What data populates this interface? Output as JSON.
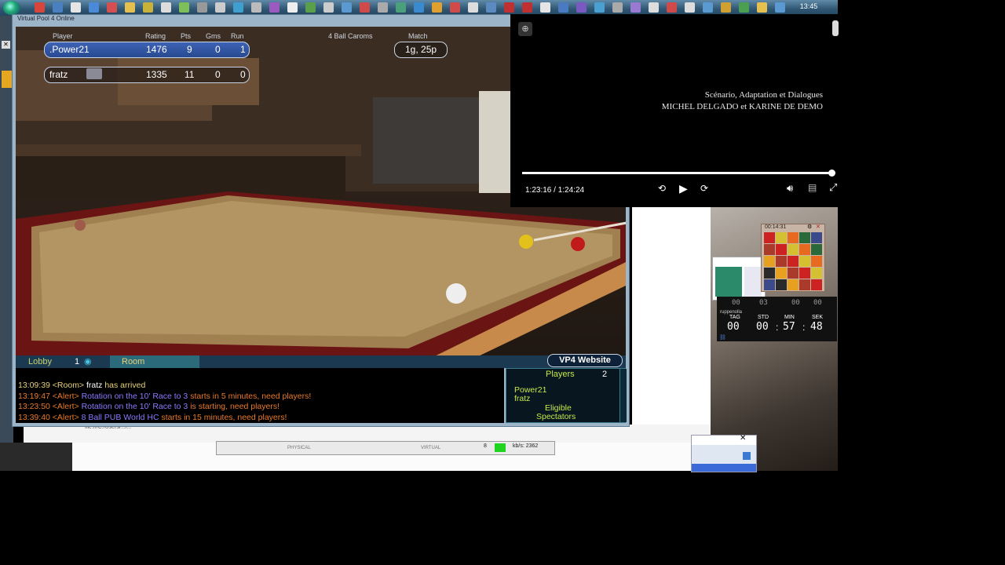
{
  "taskbar": {
    "clock": "13:45",
    "icons": [
      {
        "name": "browser-icon",
        "color": "#d9453a"
      },
      {
        "name": "search-icon",
        "color": "#4a7fc1"
      },
      {
        "name": "app-icon",
        "color": "#e5e5e5"
      },
      {
        "name": "shield-icon",
        "color": "#4a8ad8"
      },
      {
        "name": "mail-icon",
        "color": "#d45050"
      },
      {
        "name": "folder-icon",
        "color": "#e5c050"
      },
      {
        "name": "key-icon",
        "color": "#c9b23a"
      },
      {
        "name": "monitor-icon",
        "color": "#ddd"
      },
      {
        "name": "network-icon",
        "color": "#7fbf5a"
      },
      {
        "name": "settings-icon",
        "color": "#999"
      },
      {
        "name": "disc-icon",
        "color": "#ccc"
      },
      {
        "name": "globe-icon",
        "color": "#3fa0d0"
      },
      {
        "name": "app-icon",
        "color": "#bbb"
      },
      {
        "name": "media-icon",
        "color": "#9a5ac0"
      },
      {
        "name": "document-icon",
        "color": "#eee"
      },
      {
        "name": "leaf-icon",
        "color": "#5aa04a"
      },
      {
        "name": "star-icon",
        "color": "#ccc"
      },
      {
        "name": "chart-icon",
        "color": "#5a9ad0"
      },
      {
        "name": "image-icon",
        "color": "#d04a4a"
      },
      {
        "name": "gear-icon",
        "color": "#aaa"
      },
      {
        "name": "map-icon",
        "color": "#4aa07a"
      },
      {
        "name": "web-icon",
        "color": "#3a8ad0"
      },
      {
        "name": "edit-icon",
        "color": "#e0a030"
      },
      {
        "name": "play-icon",
        "color": "#d04a4a"
      },
      {
        "name": "sync-icon",
        "color": "#ddd"
      },
      {
        "name": "cloud-icon",
        "color": "#5a8ac0"
      },
      {
        "name": "record-icon",
        "color": "#c03030"
      },
      {
        "name": "record-icon",
        "color": "#c03030"
      },
      {
        "name": "cursor-icon",
        "color": "#e5e5e5"
      },
      {
        "name": "app-icon",
        "color": "#4a7ac0"
      },
      {
        "name": "chat-icon",
        "color": "#7a5ac0"
      },
      {
        "name": "check-icon",
        "color": "#4aa0d0"
      },
      {
        "name": "app-icon",
        "color": "#aaa"
      },
      {
        "name": "circle-icon",
        "color": "#9a7ad0"
      },
      {
        "name": "volume-icon",
        "color": "#ddd"
      },
      {
        "name": "flag-icon",
        "color": "#d04a4a"
      },
      {
        "name": "power-icon",
        "color": "#ddd"
      },
      {
        "name": "globe-icon",
        "color": "#5a9ad0"
      },
      {
        "name": "chrome-icon",
        "color": "#d0a030"
      },
      {
        "name": "chrome-icon",
        "color": "#4aa050"
      },
      {
        "name": "folder-icon",
        "color": "#e5c050"
      },
      {
        "name": "app-icon",
        "color": "#5a9ad0"
      }
    ]
  },
  "game": {
    "window_title": "Virtual Pool 4 Online",
    "headers": {
      "player": "Player",
      "rating": "Rating",
      "pts": "Pts",
      "gms": "Gms",
      "run": "Run",
      "mode": "4 Ball Caroms",
      "match": "Match"
    },
    "match_value": "1g, 25p",
    "players": [
      {
        "name": ".Power21",
        "rating": "1476",
        "pts": "9",
        "gms": "0",
        "run": "1"
      },
      {
        "name": "fratz",
        "rating": "1335",
        "pts": "11",
        "gms": "0",
        "run": "0"
      }
    ],
    "tabs": {
      "lobby": "Lobby",
      "lobby_count": "1",
      "room": "Room"
    },
    "website_button": "VP4 Website",
    "chat": [
      {
        "time": "13:09:39",
        "tag": "<Room>",
        "text": "fratz has arrived",
        "user": "fratz",
        "rest": " has arrived"
      },
      {
        "time": "13:19:47",
        "tag": "<Alert>",
        "text": "Rotation on the 10' Race to 3 starts in 5 minutes, need players!",
        "pre": "Rotation on the 10' Race to 3 ",
        "post": "starts in 5 minutes, need players!"
      },
      {
        "time": "13:23:50",
        "tag": "<Alert>",
        "text": "Rotation on the 10' Race to 3 is starting, need players!",
        "pre": "Rotation on the 10' Race to 3 ",
        "post": "is starting, need players!"
      },
      {
        "time": "13:39:40",
        "tag": "<Alert>",
        "text": "8 Ball PUB World HC starts in 15 minutes, need players!",
        "pre": "8 Ball PUB World HC ",
        "post": "starts in 15 minutes, need players!"
      }
    ],
    "players_panel": {
      "title": "Players",
      "count": "2",
      "names": [
        "Power21",
        "fratz"
      ],
      "eligible": "Eligible",
      "spectators": "Spectators"
    },
    "colors": {
      "chat_time": "#e87a2a",
      "chat_text_alert": "#8a7aff",
      "chat_alert_post": "#e87a2a",
      "chat_user": "#ffffff",
      "chat_room_msg": "#e8d27a",
      "player_names": "#c8e84a",
      "table_felt": "#b39463"
    }
  },
  "video": {
    "credits_line1": "Scénario, Adaptation et Dialogues",
    "credits_line2": "MICHEL DELGADO et KARINE DE DEMO",
    "time": "1:23:16 / 1:24:24",
    "progress": 0.987
  },
  "widgets": {
    "puzzle_time": "00:14:31",
    "timer_top": [
      "00",
      "03",
      "00",
      "00"
    ],
    "timer_user": "ruppenolla",
    "timer_labels": [
      "TAG",
      "STD",
      "MIN",
      "SEK"
    ],
    "timer_values": [
      "00",
      "00",
      "57",
      "48"
    ]
  },
  "status": {
    "desktop_text": "file:///C:/Users/.../...",
    "strip_left": "PHYSICAL",
    "strip_right": "VIRTUAL",
    "kbps": "kb/s: 2362",
    "strip_num": "8"
  }
}
